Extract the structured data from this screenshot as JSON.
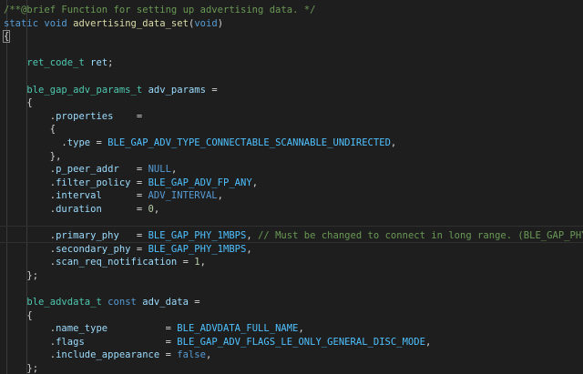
{
  "colors": {
    "background": "#1e1e1e",
    "comment": "#6a9955",
    "keyword": "#569cd6",
    "type": "#4ec9b0",
    "function": "#dcdcaa",
    "variable": "#9cdcfe",
    "number": "#b5cea8",
    "macro": "#4fc1ff",
    "plain": "#d4d4d4"
  },
  "lines": [
    {
      "tokens": [
        {
          "t": "/**@brief Function for setting up advertising data. */",
          "c": "cm"
        }
      ]
    },
    {
      "tokens": [
        {
          "t": "static",
          "c": "kw"
        },
        {
          "t": " ",
          "c": "pl"
        },
        {
          "t": "void",
          "c": "kw"
        },
        {
          "t": " ",
          "c": "pl"
        },
        {
          "t": "advertising_data_set",
          "c": "fn"
        },
        {
          "t": "(",
          "c": "pl"
        },
        {
          "t": "void",
          "c": "kw"
        },
        {
          "t": ")",
          "c": "pl"
        }
      ]
    },
    {
      "tokens": [
        {
          "t": "{",
          "c": "bm"
        }
      ]
    },
    {
      "tokens": []
    },
    {
      "tokens": [
        {
          "t": "    ",
          "c": "pl"
        },
        {
          "t": "ret_code_t",
          "c": "ty"
        },
        {
          "t": " ",
          "c": "pl"
        },
        {
          "t": "ret",
          "c": "va"
        },
        {
          "t": ";",
          "c": "pl"
        }
      ]
    },
    {
      "tokens": []
    },
    {
      "tokens": [
        {
          "t": "    ",
          "c": "pl"
        },
        {
          "t": "ble_gap_adv_params_t",
          "c": "ty"
        },
        {
          "t": " ",
          "c": "pl"
        },
        {
          "t": "adv_params",
          "c": "va"
        },
        {
          "t": " =",
          "c": "pl"
        }
      ]
    },
    {
      "tokens": [
        {
          "t": "    {",
          "c": "pl"
        }
      ]
    },
    {
      "tokens": [
        {
          "t": "        .",
          "c": "pl"
        },
        {
          "t": "properties",
          "c": "va"
        },
        {
          "t": "    =",
          "c": "pl"
        }
      ]
    },
    {
      "tokens": [
        {
          "t": "        {",
          "c": "pl"
        }
      ]
    },
    {
      "tokens": [
        {
          "t": "          .",
          "c": "pl"
        },
        {
          "t": "type",
          "c": "va"
        },
        {
          "t": " = ",
          "c": "pl"
        },
        {
          "t": "BLE_GAP_ADV_TYPE_CONNECTABLE_SCANNABLE_UNDIRECTED",
          "c": "mc"
        },
        {
          "t": ",",
          "c": "pl"
        }
      ]
    },
    {
      "tokens": [
        {
          "t": "        },",
          "c": "pl"
        }
      ]
    },
    {
      "tokens": [
        {
          "t": "        .",
          "c": "pl"
        },
        {
          "t": "p_peer_addr",
          "c": "va"
        },
        {
          "t": "   = ",
          "c": "pl"
        },
        {
          "t": "NULL",
          "c": "kw"
        },
        {
          "t": ",",
          "c": "pl"
        }
      ]
    },
    {
      "tokens": [
        {
          "t": "        .",
          "c": "pl"
        },
        {
          "t": "filter_policy",
          "c": "va"
        },
        {
          "t": " = ",
          "c": "pl"
        },
        {
          "t": "BLE_GAP_ADV_FP_ANY",
          "c": "mc"
        },
        {
          "t": ",",
          "c": "pl"
        }
      ]
    },
    {
      "tokens": [
        {
          "t": "        .",
          "c": "pl"
        },
        {
          "t": "interval",
          "c": "va"
        },
        {
          "t": "      = ",
          "c": "pl"
        },
        {
          "t": "ADV_INTERVAL",
          "c": "kw"
        },
        {
          "t": ",",
          "c": "pl"
        }
      ]
    },
    {
      "tokens": [
        {
          "t": "        .",
          "c": "pl"
        },
        {
          "t": "duration",
          "c": "va"
        },
        {
          "t": "      = ",
          "c": "pl"
        },
        {
          "t": "0",
          "c": "nu"
        },
        {
          "t": ",",
          "c": "pl"
        }
      ]
    },
    {
      "tokens": []
    },
    {
      "tokens": [
        {
          "t": "        .",
          "c": "pl"
        },
        {
          "t": "primary_phy",
          "c": "va"
        },
        {
          "t": "   = ",
          "c": "pl"
        },
        {
          "t": "BLE_GAP_PHY_1MBPS",
          "c": "mc"
        },
        {
          "t": ", ",
          "c": "pl"
        },
        {
          "t": "// Must be changed to connect in long range. (BLE_GAP_PHY_CODED)",
          "c": "cm"
        }
      ]
    },
    {
      "tokens": [
        {
          "t": "        .",
          "c": "pl"
        },
        {
          "t": "secondary_phy",
          "c": "va"
        },
        {
          "t": " = ",
          "c": "pl"
        },
        {
          "t": "BLE_GAP_PHY_1MBPS",
          "c": "mc"
        },
        {
          "t": ",",
          "c": "pl"
        }
      ]
    },
    {
      "tokens": [
        {
          "t": "        .",
          "c": "pl"
        },
        {
          "t": "scan_req_notification",
          "c": "va"
        },
        {
          "t": " = ",
          "c": "pl"
        },
        {
          "t": "1",
          "c": "nu"
        },
        {
          "t": ",",
          "c": "pl"
        }
      ]
    },
    {
      "tokens": [
        {
          "t": "    };",
          "c": "pl"
        }
      ]
    },
    {
      "tokens": []
    },
    {
      "tokens": [
        {
          "t": "    ",
          "c": "pl"
        },
        {
          "t": "ble_advdata_t",
          "c": "ty"
        },
        {
          "t": " ",
          "c": "pl"
        },
        {
          "t": "const",
          "c": "kw"
        },
        {
          "t": " ",
          "c": "pl"
        },
        {
          "t": "adv_data",
          "c": "va"
        },
        {
          "t": " =",
          "c": "pl"
        }
      ]
    },
    {
      "tokens": [
        {
          "t": "    {",
          "c": "pl"
        }
      ]
    },
    {
      "tokens": [
        {
          "t": "        .",
          "c": "pl"
        },
        {
          "t": "name_type",
          "c": "va"
        },
        {
          "t": "          = ",
          "c": "pl"
        },
        {
          "t": "BLE_ADVDATA_FULL_NAME",
          "c": "mc"
        },
        {
          "t": ",",
          "c": "pl"
        }
      ]
    },
    {
      "tokens": [
        {
          "t": "        .",
          "c": "pl"
        },
        {
          "t": "flags",
          "c": "va"
        },
        {
          "t": "              = ",
          "c": "pl"
        },
        {
          "t": "BLE_GAP_ADV_FLAGS_LE_ONLY_GENERAL_DISC_MODE",
          "c": "mc"
        },
        {
          "t": ",",
          "c": "pl"
        }
      ]
    },
    {
      "tokens": [
        {
          "t": "        .",
          "c": "pl"
        },
        {
          "t": "include_appearance",
          "c": "va"
        },
        {
          "t": " = ",
          "c": "pl"
        },
        {
          "t": "false",
          "c": "kw"
        },
        {
          "t": ",",
          "c": "pl"
        }
      ]
    },
    {
      "tokens": [
        {
          "t": "    };",
          "c": "pl"
        }
      ]
    }
  ]
}
